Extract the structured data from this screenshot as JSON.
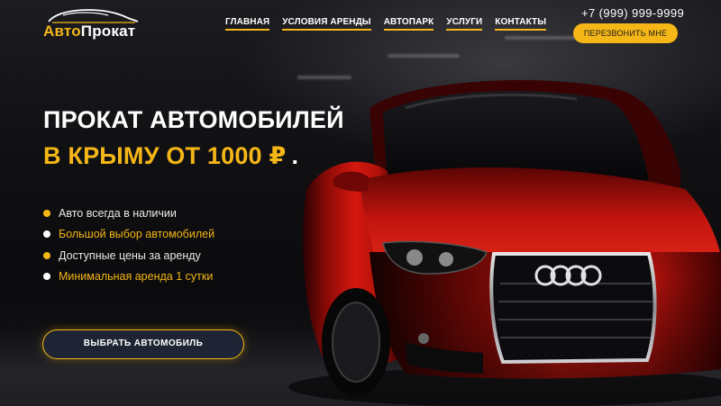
{
  "brand": {
    "logo_part1": "Авто",
    "logo_part2": "Прокат"
  },
  "nav": {
    "items": [
      {
        "label": "ГЛАВНАЯ"
      },
      {
        "label": "УСЛОВИЯ АРЕНДЫ"
      },
      {
        "label": "АВТОПАРК"
      },
      {
        "label": "УСЛУГИ"
      },
      {
        "label": "КОНТАКТЫ"
      }
    ]
  },
  "contact": {
    "phone": "+7 (999) 999-9999",
    "callback_label": "ПЕРЕЗВОНИТЬ МНЕ"
  },
  "hero": {
    "title_line1": "ПРОКАТ АВТОМОБИЛЕЙ",
    "title_line2": "В КРЫМУ ОТ 1000 ₽",
    "title_dot": ".",
    "features": [
      {
        "text": "Авто всегда в наличии",
        "bullet": "yellow",
        "text_color": "white"
      },
      {
        "text": "Большой выбор автомобилей",
        "bullet": "white",
        "text_color": "yellow"
      },
      {
        "text": "Доступные цены за аренду",
        "bullet": "yellow",
        "text_color": "white"
      },
      {
        "text": "Минимальная аренда 1 сутки",
        "bullet": "white",
        "text_color": "yellow"
      }
    ],
    "cta_label": "ВЫБРАТЬ АВТОМОБИЛЬ"
  },
  "colors": {
    "accent": "#f5b617",
    "background": "#0d0d0f",
    "cta_bg": "#1e2433",
    "car_red": "#c0140f"
  }
}
